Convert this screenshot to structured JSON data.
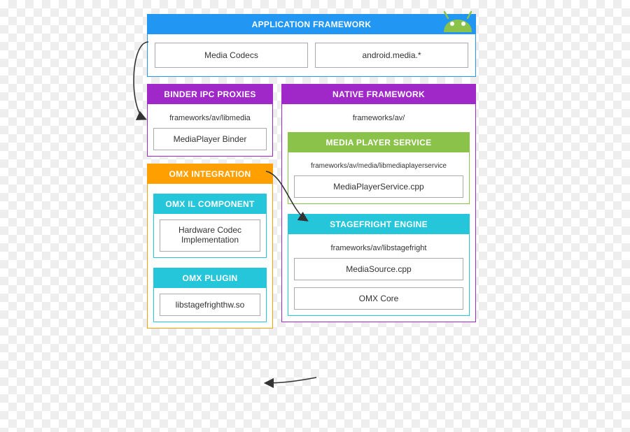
{
  "app_framework": {
    "title": "APPLICATION FRAMEWORK",
    "boxes": [
      "Media Codecs",
      "android.media.*"
    ]
  },
  "binder": {
    "title": "BINDER IPC PROXIES",
    "path": "frameworks/av/libmedia",
    "box": "MediaPlayer Binder"
  },
  "native": {
    "title": "NATIVE FRAMEWORK",
    "path": "frameworks/av/",
    "mps": {
      "title": "MEDIA PLAYER SERVICE",
      "path": "frameworks/av/media/libmediaplayerservice",
      "box": "MediaPlayerService.cpp"
    },
    "stagefright": {
      "title": "STAGEFRIGHT ENGINE",
      "path": "frameworks/av/libstagefright",
      "box1": "MediaSource.cpp",
      "box2": "OMX Core"
    }
  },
  "omx": {
    "title": "OMX INTEGRATION",
    "il": {
      "title": "OMX IL COMPONENT",
      "box_l1": "Hardware Codec",
      "box_l2": "Implementation"
    },
    "plugin": {
      "title": "OMX PLUGIN",
      "box": "libstagefrighthw.so"
    }
  }
}
